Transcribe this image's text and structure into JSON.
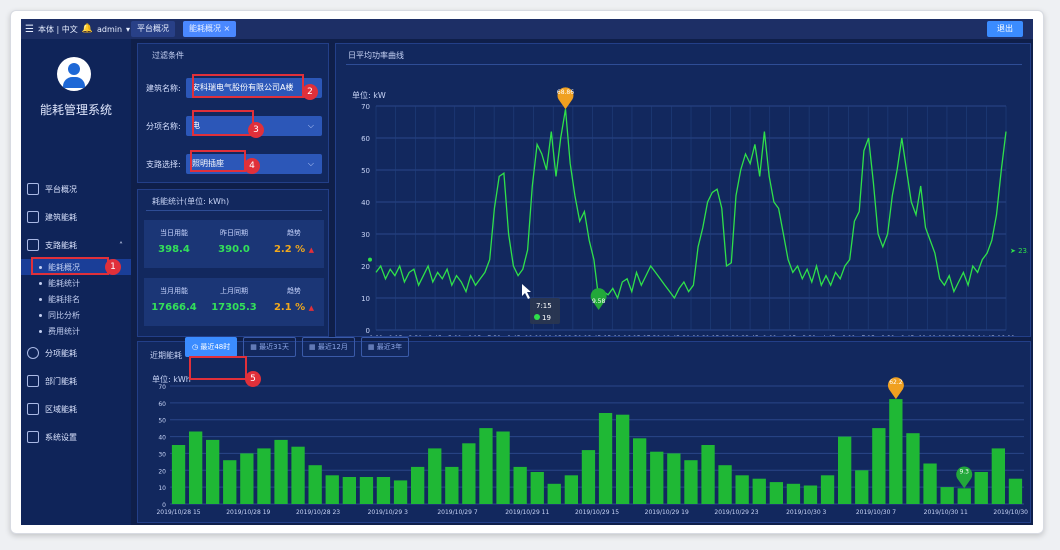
{
  "topbar": {
    "menu_icon": "hamburger-icon",
    "left_text": "本体 | 中文",
    "bell_icon": "bell-icon",
    "user": "admin",
    "tabs": [
      {
        "label": "平台概况"
      },
      {
        "label": "能耗概况 ×"
      }
    ],
    "exit_label": "退出"
  },
  "sidebar": {
    "system_name": "能耗管理系统",
    "items": [
      {
        "label": "平台概况",
        "icon": "monitor-icon"
      },
      {
        "label": "建筑能耗",
        "icon": "building-icon"
      },
      {
        "label": "支路能耗",
        "icon": "grid-icon"
      }
    ],
    "sub_items": [
      {
        "label": "能耗概况",
        "active": true
      },
      {
        "label": "能耗统计",
        "active": false
      },
      {
        "label": "能耗排名",
        "active": false
      },
      {
        "label": "同比分析",
        "active": false
      },
      {
        "label": "费用统计",
        "active": false
      }
    ],
    "items2": [
      {
        "label": "分项能耗",
        "icon": "clock-icon"
      },
      {
        "label": "部门能耗",
        "icon": "folder-icon"
      },
      {
        "label": "区域能耗",
        "icon": "region-icon"
      },
      {
        "label": "系统设置",
        "icon": "settings-icon"
      }
    ]
  },
  "filter": {
    "title": "过滤条件",
    "building_label": "建筑名称:",
    "building_value": "安科瑞电气股份有限公司A楼",
    "type_label": "分项名称:",
    "type_value": "电",
    "branch_label": "支路选择:",
    "branch_value": "照明插座"
  },
  "stats": {
    "title": "耗能统计(单位: kWh)",
    "cells": [
      {
        "label": "当日用能",
        "value": "398.4"
      },
      {
        "label": "昨日同期",
        "value": "390.0"
      },
      {
        "label": "趋势",
        "value": "2.2 %",
        "arrow": "▲"
      },
      {
        "label": "当月用能",
        "value": "17666.4"
      },
      {
        "label": "上月同期",
        "value": "17305.3"
      },
      {
        "label": "趋势",
        "value": "2.1 %",
        "arrow": "▲"
      }
    ]
  },
  "chart1": {
    "title": "日平均功率曲线",
    "unit": "单位: kW",
    "max_label": "68.86",
    "min_label": "9.58",
    "last_label": "23.48",
    "tooltip_time": "7:15",
    "tooltip_value": "19"
  },
  "chart2": {
    "section_label": "近期能耗",
    "tabs": [
      {
        "label": "最近48时",
        "icon": "clock-icon"
      },
      {
        "label": "最近31天",
        "icon": "calendar-icon"
      },
      {
        "label": "最近12月",
        "icon": "calendar-icon"
      },
      {
        "label": "最近3年",
        "icon": "calendar-icon"
      }
    ],
    "unit": "单位: kWh",
    "max_label": "62.2",
    "min_label": "9.3"
  },
  "callouts": [
    "1",
    "2",
    "3",
    "4",
    "5"
  ],
  "chart_data": [
    {
      "type": "line",
      "title": "日平均功率曲线",
      "ylabel": "单位: kW",
      "ylim": [
        0,
        70
      ],
      "yticks": [
        0,
        10,
        20,
        30,
        40,
        50,
        60,
        70
      ],
      "xticks": [
        "0:00",
        "1:15",
        "2:30",
        "3:45",
        "5:00",
        "6:15",
        "7:30",
        "8:45",
        "10:00",
        "11:15",
        "12:30",
        "13:45",
        "15:00",
        "16:15",
        "17:30",
        "18:45",
        "20:00",
        "21:15",
        "22:30",
        "23:45",
        "1:00",
        "2:15",
        "3:30",
        "4:45",
        "6:00",
        "7:15",
        "8:30",
        "9:45",
        "11:00",
        "12:15",
        "13:30",
        "14:45",
        "16:00"
      ],
      "series": [
        {
          "values": [
            18,
            20,
            16,
            19,
            17,
            20,
            15,
            18,
            19,
            14,
            17,
            20,
            15,
            18,
            16,
            19,
            14,
            17,
            15,
            12,
            17,
            14,
            16,
            18,
            22,
            38,
            48,
            49,
            30,
            20,
            17,
            19,
            25,
            45,
            58,
            55,
            50,
            62,
            48,
            60,
            69,
            52,
            42,
            34,
            37,
            28,
            22,
            10,
            12,
            11,
            13,
            10,
            15,
            16,
            12,
            18,
            14,
            17,
            20,
            18,
            16,
            14,
            12,
            10,
            13,
            15,
            12,
            14,
            26,
            32,
            40,
            43,
            44,
            38,
            20,
            21,
            42,
            50,
            55,
            52,
            58,
            48,
            62,
            48,
            40,
            38,
            30,
            22,
            18,
            20,
            16,
            19,
            15,
            20,
            14,
            17,
            14,
            18,
            16,
            20,
            22,
            34,
            37,
            56,
            60,
            46,
            30,
            26,
            30,
            42,
            50,
            60,
            50,
            40,
            36,
            45,
            32,
            28,
            24,
            16,
            14,
            17,
            12,
            15,
            18,
            14,
            20,
            18,
            22,
            24,
            28,
            36,
            50,
            62
          ]
        }
      ]
    },
    {
      "type": "bar",
      "ylabel": "单位: kWh",
      "ylim": [
        0,
        70
      ],
      "yticks": [
        0,
        10,
        20,
        30,
        40,
        50,
        60,
        70
      ],
      "xticks": [
        "2019/10/28 15",
        "2019/10/28 19",
        "2019/10/28 23",
        "2019/10/29 3",
        "2019/10/29 7",
        "2019/10/29 11",
        "2019/10/29 15",
        "2019/10/29 19",
        "2019/10/29 23",
        "2019/10/30 3",
        "2019/10/30 7",
        "2019/10/30 11",
        "2019/10/30 15"
      ],
      "series": [
        {
          "values": [
            35,
            43,
            38,
            26,
            30,
            33,
            38,
            34,
            23,
            17,
            16,
            16,
            16,
            14,
            22,
            33,
            22,
            36,
            45,
            43,
            22,
            19,
            12,
            17,
            32,
            54,
            53,
            39,
            31,
            30,
            26,
            35,
            23,
            17,
            15,
            13,
            12,
            11,
            17,
            40,
            20,
            45,
            62.2,
            42,
            24,
            10,
            9.3,
            19,
            33,
            15
          ]
        }
      ]
    }
  ]
}
